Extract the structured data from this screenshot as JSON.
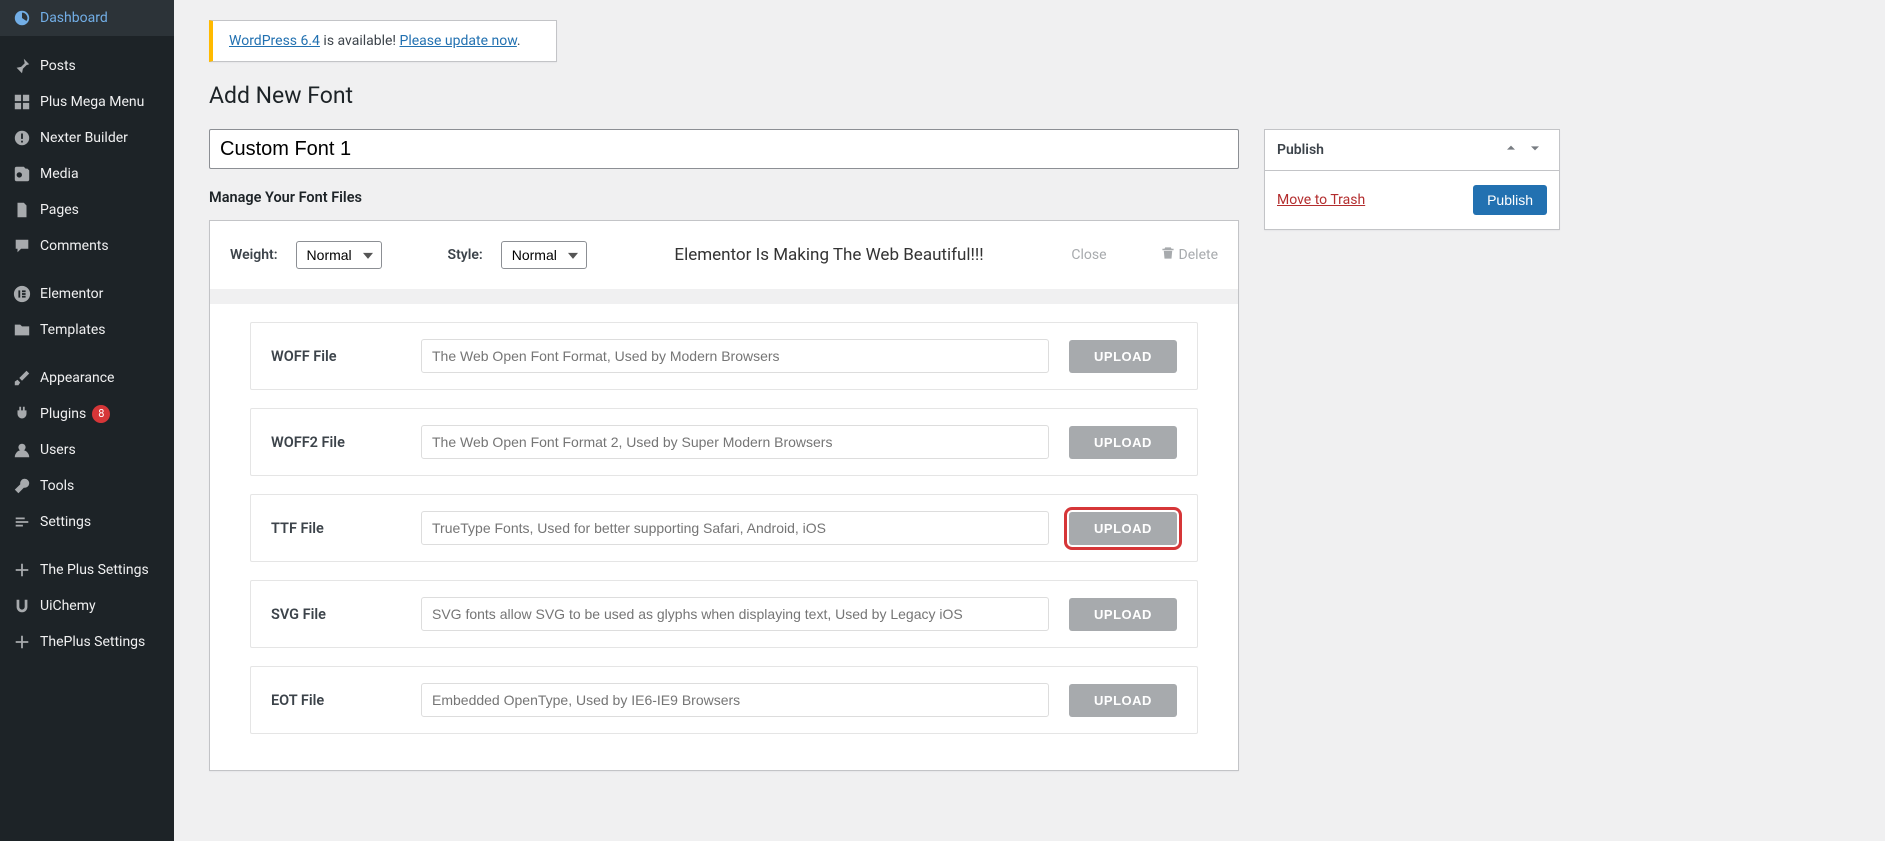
{
  "sidebar": {
    "items": [
      {
        "key": "dashboard",
        "label": "Dashboard"
      },
      {
        "key": "posts",
        "label": "Posts"
      },
      {
        "key": "plus-mega-menu",
        "label": "Plus Mega Menu"
      },
      {
        "key": "nexter-builder",
        "label": "Nexter Builder"
      },
      {
        "key": "media",
        "label": "Media"
      },
      {
        "key": "pages",
        "label": "Pages"
      },
      {
        "key": "comments",
        "label": "Comments"
      },
      {
        "key": "elementor",
        "label": "Elementor"
      },
      {
        "key": "templates",
        "label": "Templates"
      },
      {
        "key": "appearance",
        "label": "Appearance"
      },
      {
        "key": "plugins",
        "label": "Plugins",
        "badge": "8"
      },
      {
        "key": "users",
        "label": "Users"
      },
      {
        "key": "tools",
        "label": "Tools"
      },
      {
        "key": "settings",
        "label": "Settings"
      },
      {
        "key": "the-plus-settings",
        "label": "The Plus Settings"
      },
      {
        "key": "uichemy",
        "label": "UiChemy"
      },
      {
        "key": "theplus-settings",
        "label": "ThePlus Settings"
      }
    ]
  },
  "notice": {
    "link1": "WordPress 6.4",
    "mid": " is available! ",
    "link2": "Please update now",
    "tail": "."
  },
  "page": {
    "title": "Add New Font"
  },
  "form": {
    "title_value": "Custom Font 1",
    "section_label": "Manage Your Font Files",
    "weight_label": "Weight:",
    "weight_value": "Normal",
    "style_label": "Style:",
    "style_value": "Normal",
    "preview_text": "Elementor Is Making The Web Beautiful!!!",
    "close_label": "Close",
    "delete_label": "Delete"
  },
  "files": {
    "upload_label": "UPLOAD",
    "rows": [
      {
        "label": "WOFF File",
        "placeholder": "The Web Open Font Format, Used by Modern Browsers",
        "highlight": false
      },
      {
        "label": "WOFF2 File",
        "placeholder": "The Web Open Font Format 2, Used by Super Modern Browsers",
        "highlight": false
      },
      {
        "label": "TTF File",
        "placeholder": "TrueType Fonts, Used for better supporting Safari, Android, iOS",
        "highlight": true
      },
      {
        "label": "SVG File",
        "placeholder": "SVG fonts allow SVG to be used as glyphs when displaying text, Used by Legacy iOS",
        "highlight": false
      },
      {
        "label": "EOT File",
        "placeholder": "Embedded OpenType, Used by IE6-IE9 Browsers",
        "highlight": false
      }
    ]
  },
  "publish": {
    "title": "Publish",
    "trash": "Move to Trash",
    "button": "Publish"
  }
}
